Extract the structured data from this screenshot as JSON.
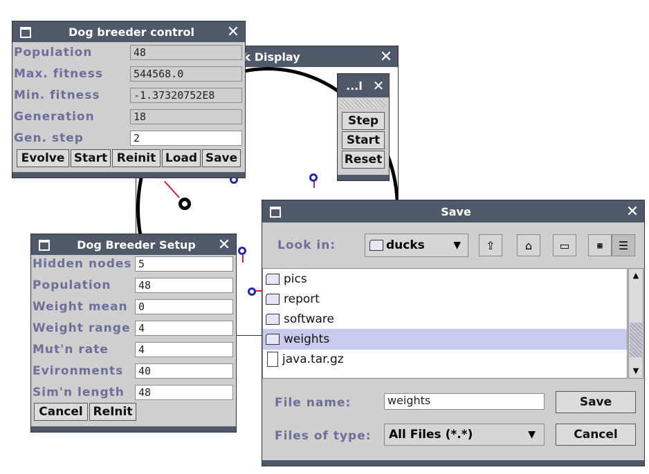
{
  "breeder_control": {
    "title": "Dog breeder control",
    "rows": [
      {
        "label": "Population",
        "value": "48",
        "editable": false
      },
      {
        "label": "Max. fitness",
        "value": "544568.0",
        "editable": false
      },
      {
        "label": "Min. fitness",
        "value": "-1.37320752E8",
        "editable": false
      },
      {
        "label": "Generation",
        "value": "18",
        "editable": false
      },
      {
        "label": "Gen. step",
        "value": "2",
        "editable": true
      }
    ],
    "buttons": [
      "Evolve",
      "Start",
      "Reinit",
      "Load",
      "Save"
    ]
  },
  "display_window": {
    "title": "ck Display"
  },
  "mini_control": {
    "title": "...l",
    "buttons": [
      "Step",
      "Start",
      "Reset"
    ]
  },
  "setup": {
    "title": "Dog Breeder Setup",
    "rows": [
      {
        "label": "Hidden nodes",
        "value": "5"
      },
      {
        "label": "Population",
        "value": "48"
      },
      {
        "label": "Weight mean",
        "value": "0"
      },
      {
        "label": "Weight range",
        "value": "4"
      },
      {
        "label": "Mut'n rate",
        "value": "4"
      },
      {
        "label": "Evironments",
        "value": "40"
      },
      {
        "label": "Sim'n length",
        "value": "48"
      }
    ],
    "buttons": [
      "Cancel",
      "ReInit"
    ]
  },
  "save_dialog": {
    "title": "Save",
    "look_in_label": "Look in:",
    "look_in_value": "ducks",
    "files": [
      {
        "name": "pics",
        "type": "folder"
      },
      {
        "name": "report",
        "type": "folder"
      },
      {
        "name": "software",
        "type": "folder"
      },
      {
        "name": "weights",
        "type": "folder",
        "selected": true
      },
      {
        "name": "java.tar.gz",
        "type": "file"
      }
    ],
    "file_name_label": "File name:",
    "file_name_value": "weights",
    "files_of_type_label": "Files of type:",
    "files_of_type_value": "All Files (*.*)",
    "save_label": "Save",
    "cancel_label": "Cancel"
  },
  "colors": {
    "titlebar": "#50596a",
    "label": "#6e6e9a",
    "selection": "#c8cbec"
  }
}
